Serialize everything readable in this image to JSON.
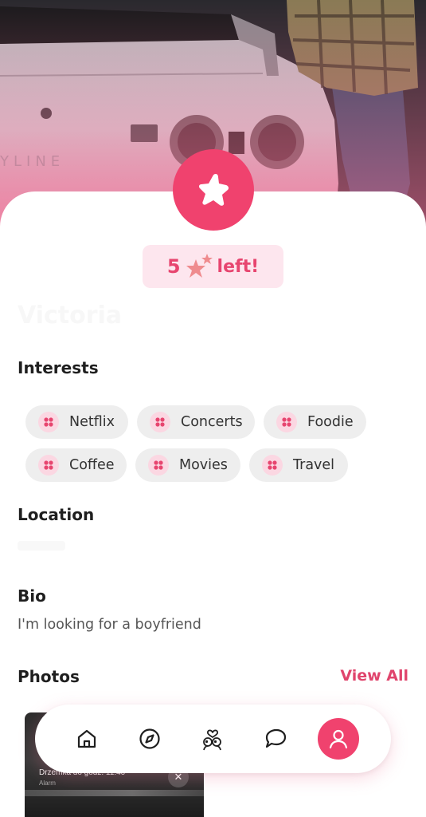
{
  "profile": {
    "stars_remaining": "5",
    "stars_suffix": "left!",
    "name": "Victoria"
  },
  "sections": {
    "interests_title": "Interests",
    "location_title": "Location",
    "bio_title": "Bio",
    "photos_title": "Photos",
    "view_all_label": "View All"
  },
  "interests": [
    {
      "label": "Netflix"
    },
    {
      "label": "Concerts"
    },
    {
      "label": "Foodie"
    },
    {
      "label": "Coffee"
    },
    {
      "label": "Movies"
    },
    {
      "label": "Travel"
    }
  ],
  "bio": "I'm looking for a boyfriend",
  "photo_preview": {
    "notification_title": "Drzemka do godz. 11:40",
    "notification_subtitle": "Alarm"
  },
  "nav": {
    "items": [
      {
        "icon": "home-icon"
      },
      {
        "icon": "compass-icon"
      },
      {
        "icon": "match-icon"
      },
      {
        "icon": "chat-icon"
      },
      {
        "icon": "profile-icon",
        "active": true
      }
    ]
  },
  "colors": {
    "accent": "#f0426e",
    "accent_text": "#e0446c",
    "pill_background": "#fde6ee",
    "chip_background": "#eeeeee",
    "chip_icon_background": "#fbd7e2"
  }
}
